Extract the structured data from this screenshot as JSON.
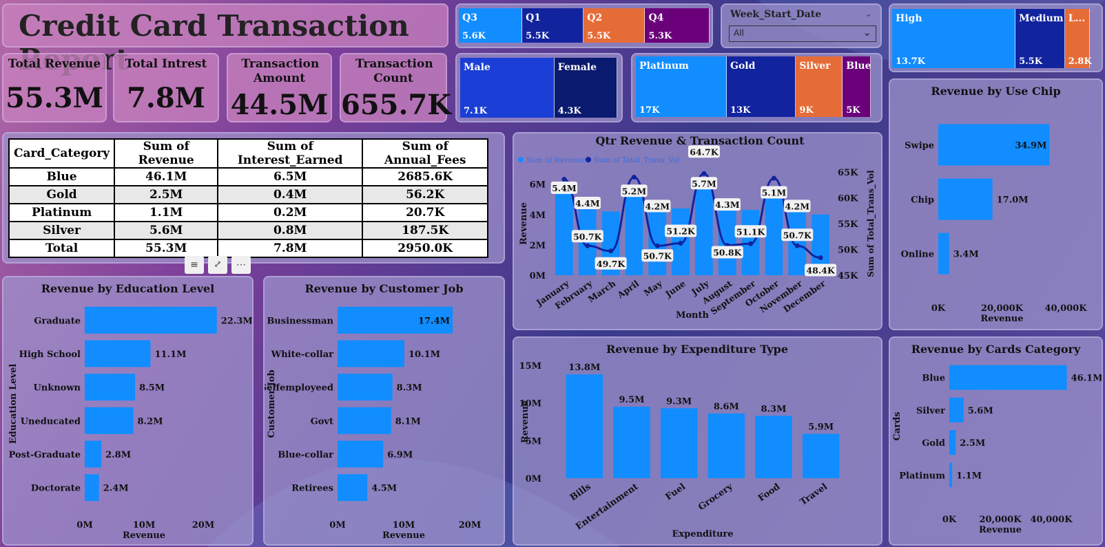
{
  "header": {
    "title": "Credit Card Transaction Report"
  },
  "kpis": [
    {
      "label": "Total Revenue",
      "value": "55.3M"
    },
    {
      "label": "Total Intrest",
      "value": "7.8M"
    },
    {
      "label": "Transaction Amount",
      "value": "44.5M"
    },
    {
      "label": "Transaction Count",
      "value": "655.7K"
    }
  ],
  "quarters": [
    {
      "name": "Q3",
      "value": "5.6K",
      "color": "#118dff"
    },
    {
      "name": "Q1",
      "value": "5.5K",
      "color": "#12239e"
    },
    {
      "name": "Q2",
      "value": "5.5K",
      "color": "#e66c37"
    },
    {
      "name": "Q4",
      "value": "5.3K",
      "color": "#6b007b"
    }
  ],
  "slicer": {
    "label": "Week_Start_Date",
    "value": "All"
  },
  "income": [
    {
      "name": "High",
      "value": "13.7K",
      "color": "#118dff"
    },
    {
      "name": "Medium",
      "value": "5.5K",
      "color": "#12239e"
    },
    {
      "name": "L...",
      "value": "2.8K",
      "color": "#e66c37"
    }
  ],
  "gender": [
    {
      "name": "Male",
      "value": "7.1K",
      "color": "#1b3fd6"
    },
    {
      "name": "Female",
      "value": "4.3K",
      "color": "#0a1a6e"
    }
  ],
  "cards": [
    {
      "name": "Platinum",
      "value": "17K",
      "color": "#118dff"
    },
    {
      "name": "Gold",
      "value": "13K",
      "color": "#12239e"
    },
    {
      "name": "Silver",
      "value": "9K",
      "color": "#e66c37"
    },
    {
      "name": "Blue",
      "value": "5K",
      "color": "#6b007b"
    }
  ],
  "table": {
    "headers": [
      "Card_Category",
      "Sum of Revenue",
      "Sum of Interest_Earned",
      "Sum of Annual_Fees"
    ],
    "rows": [
      [
        "Blue",
        "46.1M",
        "6.5M",
        "2685.6K"
      ],
      [
        "Gold",
        "2.5M",
        "0.4M",
        "56.2K"
      ],
      [
        "Platinum",
        "1.1M",
        "0.2M",
        "20.7K"
      ],
      [
        "Silver",
        "5.6M",
        "0.8M",
        "187.5K"
      ],
      [
        "Total",
        "55.3M",
        "7.8M",
        "2950.0K"
      ]
    ]
  },
  "chart_data": [
    {
      "id": "qtr",
      "type": "bar",
      "title": "Qtr Revenue & Transaction Count",
      "legend": [
        "Sum of Revenue",
        "Sum of Total_Trans_Vol"
      ],
      "xlabel": "Month",
      "ylabel": "Revenue",
      "y2label": "Sum of Total_Trans_Vol",
      "categories": [
        "January",
        "February",
        "March",
        "April",
        "May",
        "June",
        "July",
        "August",
        "September",
        "October",
        "November",
        "December"
      ],
      "series": [
        {
          "name": "Sum of Revenue",
          "type": "bar",
          "values": [
            5.4,
            4.4,
            4.2,
            5.2,
            4.2,
            4.4,
            5.7,
            4.3,
            4.3,
            5.1,
            4.2,
            4.0
          ],
          "labels": [
            "5.4M",
            "4.4M",
            "",
            "5.2M",
            "4.2M",
            "",
            "5.7M",
            "4.3M",
            "",
            "5.1M",
            "4.2M",
            ""
          ]
        },
        {
          "name": "Sum of Total_Trans_Vol",
          "type": "line",
          "values": [
            63.6,
            50.7,
            49.7,
            64.0,
            50.7,
            51.2,
            64.7,
            50.8,
            51.1,
            63.8,
            50.7,
            48.4
          ],
          "labels": [
            "",
            "50.7K",
            "49.7K",
            "",
            "50.7K",
            "51.2K",
            "64.7K",
            "50.8K",
            "51.1K",
            "",
            "50.7K",
            "48.4K"
          ]
        }
      ],
      "yticks": [
        "0M",
        "2M",
        "4M",
        "6M"
      ],
      "y2ticks": [
        "45K",
        "50K",
        "55K",
        "60K",
        "65K"
      ],
      "ylim": [
        0,
        6.8
      ],
      "y2lim": [
        45,
        65
      ]
    },
    {
      "id": "chip",
      "type": "bar",
      "orientation": "horizontal",
      "title": "Revenue by Use Chip",
      "categories": [
        "Swipe",
        "Chip",
        "Online"
      ],
      "values": [
        34.9,
        17.0,
        3.4
      ],
      "labels": [
        "34.9M",
        "17.0M",
        "3.4M"
      ],
      "xticks": [
        "0K",
        "20,000K",
        "40,000K"
      ],
      "xlim": [
        0,
        40
      ],
      "xlabel": "Revenue"
    },
    {
      "id": "edu",
      "type": "bar",
      "orientation": "horizontal",
      "title": "Revenue by Education Level",
      "categories": [
        "Graduate",
        "High School",
        "Unknown",
        "Uneducated",
        "Post-Graduate",
        "Doctorate"
      ],
      "values": [
        22.3,
        11.1,
        8.5,
        8.2,
        2.8,
        2.4
      ],
      "labels": [
        "22.3M",
        "11.1M",
        "8.5M",
        "8.2M",
        "2.8M",
        "2.4M"
      ],
      "xticks": [
        "0M",
        "10M",
        "20M"
      ],
      "xlim": [
        0,
        20
      ],
      "xlabel": "Revenue",
      "ylabel": "Education Level"
    },
    {
      "id": "job",
      "type": "bar",
      "orientation": "horizontal",
      "title": "Revenue by Customer Job",
      "categories": [
        "Businessman",
        "White-collar",
        "Selfemployeed",
        "Govt",
        "Blue-collar",
        "Retirees"
      ],
      "values": [
        17.4,
        10.1,
        8.3,
        8.1,
        6.9,
        4.5
      ],
      "labels": [
        "17.4M",
        "10.1M",
        "8.3M",
        "8.1M",
        "6.9M",
        "4.5M"
      ],
      "xticks": [
        "0M",
        "10M",
        "20M"
      ],
      "xlim": [
        0,
        20
      ],
      "xlabel": "Revenue",
      "ylabel": "Customer Job"
    },
    {
      "id": "exp",
      "type": "bar",
      "title": "Revenue by Expenditure Type",
      "categories": [
        "Bills",
        "Entertainment",
        "Fuel",
        "Grocery",
        "Food",
        "Travel"
      ],
      "values": [
        13.8,
        9.5,
        9.3,
        8.6,
        8.3,
        5.9
      ],
      "labels": [
        "13.8M",
        "9.5M",
        "9.3M",
        "8.6M",
        "8.3M",
        "5.9M"
      ],
      "yticks": [
        "0M",
        "5M",
        "10M",
        "15M"
      ],
      "ylim": [
        0,
        15
      ],
      "xlabel": "Expenditure",
      "ylabel": "Revenue"
    },
    {
      "id": "cardcat",
      "type": "bar",
      "orientation": "horizontal",
      "title": "Revenue by Cards Category",
      "categories": [
        "Blue",
        "Silver",
        "Gold",
        "Platinum"
      ],
      "values": [
        46.1,
        5.6,
        2.5,
        1.1
      ],
      "labels": [
        "46.1M",
        "5.6M",
        "2.5M",
        "1.1M"
      ],
      "xticks": [
        "0K",
        "20,000K",
        "40,000K"
      ],
      "xlim": [
        0,
        40
      ],
      "xlabel": "Revenue",
      "ylabel": "Cards"
    }
  ],
  "colors": {
    "bar": "#118dff",
    "line": "#12239e"
  }
}
